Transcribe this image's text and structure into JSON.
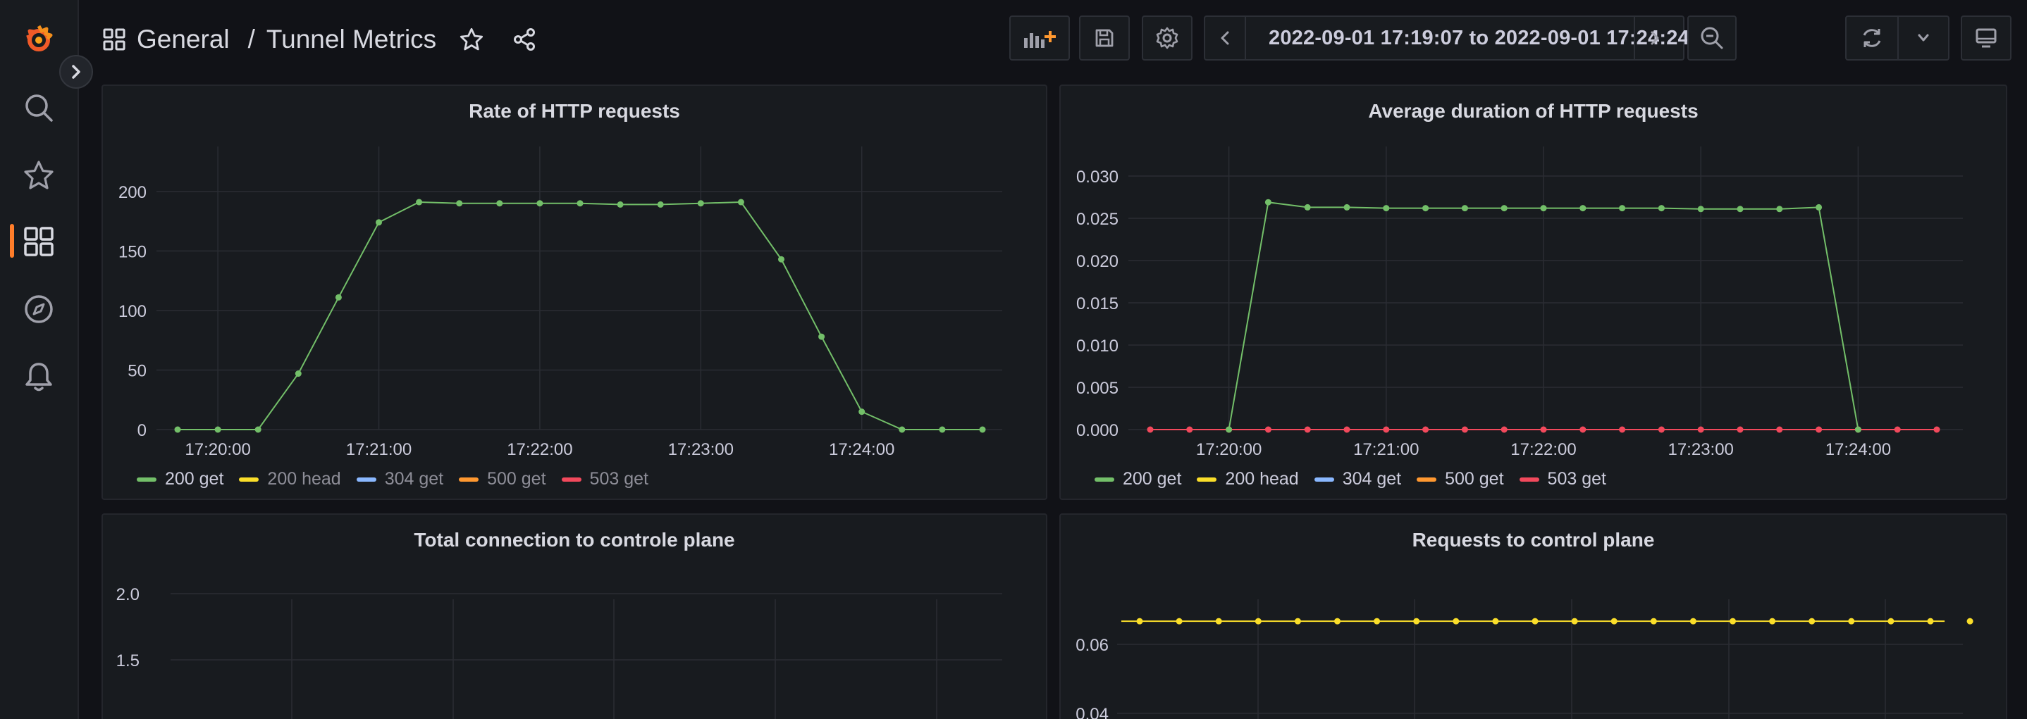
{
  "header": {
    "folder": "General",
    "separator": "/",
    "dashboard_title": "Tunnel Metrics",
    "time_range": "2022-09-01 17:19:07 to 2022-09-01 17:24:24"
  },
  "sidebar": {
    "items": [
      {
        "name": "grafana-logo-icon"
      },
      {
        "name": "search-icon"
      },
      {
        "name": "starred-icon"
      },
      {
        "name": "dashboards-icon",
        "active": true
      },
      {
        "name": "explore-icon"
      },
      {
        "name": "alerting-icon"
      }
    ]
  },
  "colors": {
    "green": "#73bf69",
    "yellow": "#fade2a",
    "blue": "#8ab8ff",
    "orange": "#ff9830",
    "red": "#f2495c",
    "accent": "#ff7d2a"
  },
  "panels": {
    "p1": {
      "title": "Rate of HTTP requests",
      "legend": [
        {
          "label": "200 get",
          "color": "#73bf69",
          "dim": false
        },
        {
          "label": "200 head",
          "color": "#fade2a",
          "dim": true
        },
        {
          "label": "304 get",
          "color": "#8ab8ff",
          "dim": true
        },
        {
          "label": "500 get",
          "color": "#ff9830",
          "dim": true
        },
        {
          "label": "503 get",
          "color": "#f2495c",
          "dim": true
        }
      ]
    },
    "p2": {
      "title": "Average duration of HTTP requests",
      "legend": [
        {
          "label": "200 get",
          "color": "#73bf69",
          "dim": false
        },
        {
          "label": "200 head",
          "color": "#fade2a",
          "dim": false
        },
        {
          "label": "304 get",
          "color": "#8ab8ff",
          "dim": false
        },
        {
          "label": "500 get",
          "color": "#ff9830",
          "dim": false
        },
        {
          "label": "503 get",
          "color": "#f2495c",
          "dim": false
        }
      ]
    },
    "p3": {
      "title": "Total connection to controle plane"
    },
    "p4": {
      "title": "Requests to control plane"
    }
  },
  "chart_data": [
    {
      "type": "line",
      "title": "Rate of HTTP requests",
      "x": [
        "17:19:45",
        "17:20:00",
        "17:20:15",
        "17:20:30",
        "17:20:45",
        "17:21:00",
        "17:21:15",
        "17:21:30",
        "17:21:45",
        "17:22:00",
        "17:22:15",
        "17:22:30",
        "17:22:45",
        "17:23:00",
        "17:23:15",
        "17:23:30",
        "17:23:45",
        "17:24:00",
        "17:24:15",
        "17:24:30",
        "17:24:45"
      ],
      "x_ticks": [
        "17:20:00",
        "17:21:00",
        "17:22:00",
        "17:23:00",
        "17:24:00"
      ],
      "ylim": [
        0,
        220
      ],
      "y_ticks": [
        0,
        50,
        100,
        150,
        200
      ],
      "series": [
        {
          "name": "200 get",
          "color": "#73bf69",
          "values": [
            0,
            0,
            0,
            47,
            111,
            174,
            191,
            190,
            190,
            190,
            190,
            189,
            189,
            190,
            191,
            143,
            78,
            15,
            0,
            0,
            0
          ]
        }
      ]
    },
    {
      "type": "line",
      "title": "Average duration of HTTP requests",
      "x": [
        "17:19:30",
        "17:19:45",
        "17:20:00",
        "17:20:15",
        "17:20:30",
        "17:20:45",
        "17:21:00",
        "17:21:15",
        "17:21:30",
        "17:21:45",
        "17:22:00",
        "17:22:15",
        "17:22:30",
        "17:22:45",
        "17:23:00",
        "17:23:15",
        "17:23:30",
        "17:23:45",
        "17:24:00",
        "17:24:15",
        "17:24:30"
      ],
      "x_ticks": [
        "17:20:00",
        "17:21:00",
        "17:22:00",
        "17:23:00",
        "17:24:00"
      ],
      "ylim": [
        0,
        0.031
      ],
      "y_ticks": [
        "0.000",
        "0.005",
        "0.010",
        "0.015",
        "0.020",
        "0.025",
        "0.030"
      ],
      "series": [
        {
          "name": "503 get",
          "color": "#f2495c",
          "values": [
            0,
            0,
            0,
            0,
            0,
            0,
            0,
            0,
            0,
            0,
            0,
            0,
            0,
            0,
            0,
            0,
            0,
            0,
            0,
            0,
            0
          ]
        },
        {
          "name": "200 get",
          "color": "#73bf69",
          "values": [
            null,
            null,
            0,
            0.0269,
            0.0263,
            0.0263,
            0.0262,
            0.0262,
            0.0262,
            0.0262,
            0.0262,
            0.0262,
            0.0262,
            0.0262,
            0.0261,
            0.0261,
            0.0261,
            0.0263,
            0,
            null,
            null
          ]
        }
      ]
    },
    {
      "type": "line",
      "title": "Total connection to controle plane",
      "y_ticks": [
        "2.0",
        "1.5"
      ],
      "series": []
    },
    {
      "type": "line",
      "title": "Requests to control plane",
      "x": [
        "17:19:30",
        "17:19:45",
        "17:20:00",
        "17:20:15",
        "17:20:30",
        "17:20:45",
        "17:21:00",
        "17:21:15",
        "17:21:30",
        "17:21:45",
        "17:22:00",
        "17:22:15",
        "17:22:30",
        "17:22:45",
        "17:23:00",
        "17:23:15",
        "17:23:30",
        "17:23:45",
        "17:24:00",
        "17:24:15",
        "17:24:30",
        "17:24:45"
      ],
      "y_ticks": [
        "0.06",
        "0.04"
      ],
      "series": [
        {
          "name": "",
          "color": "#fade2a",
          "values": [
            0.0667,
            0.0667,
            0.0667,
            0.0667,
            0.0667,
            0.0667,
            0.0667,
            0.0667,
            0.0667,
            0.0667,
            0.0667,
            0.0667,
            0.0667,
            0.0667,
            0.0667,
            0.0667,
            0.0667,
            0.0667,
            0.0667,
            0.0667,
            0.0667,
            0.0667
          ]
        }
      ]
    }
  ]
}
